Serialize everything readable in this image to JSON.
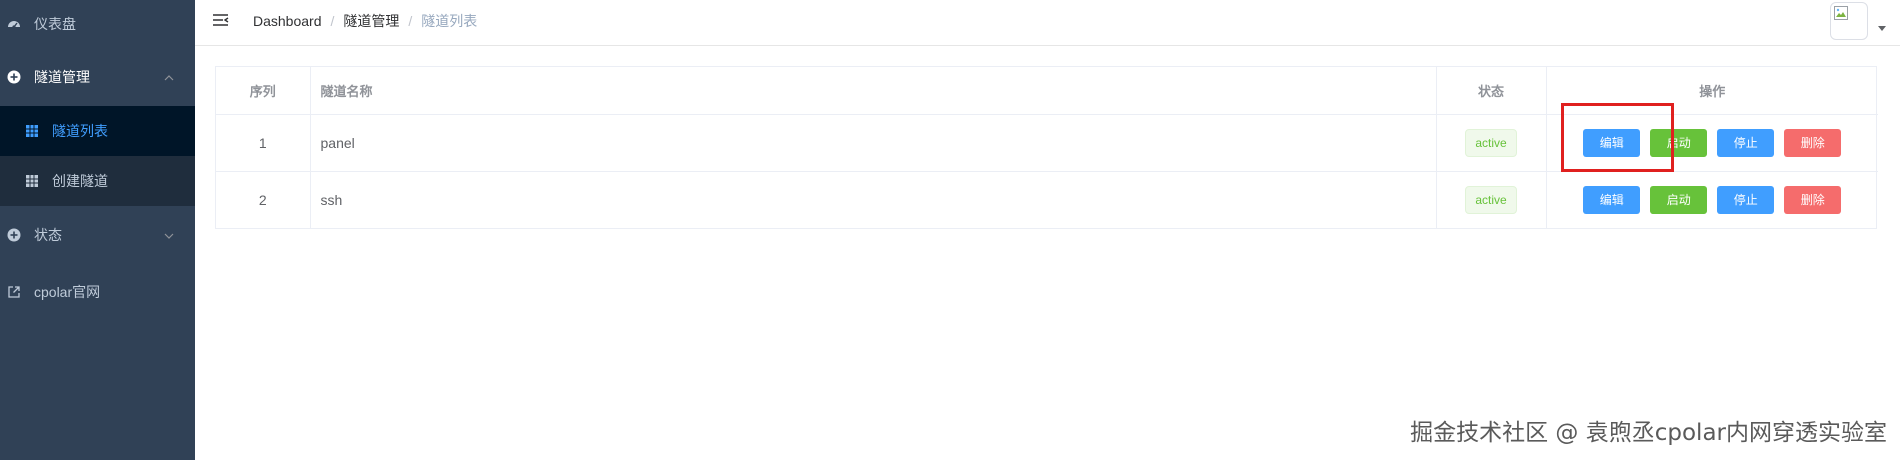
{
  "sidebar": {
    "dashboard": {
      "label": "仪表盘",
      "icon": "dashboard-icon"
    },
    "tunnel_group": {
      "label": "隧道管理",
      "icon": "plus-circle-icon",
      "expanded": true,
      "items": [
        {
          "label": "隧道列表",
          "icon": "table-icon",
          "active": true
        },
        {
          "label": "创建隧道",
          "icon": "table-icon",
          "active": false
        }
      ]
    },
    "status_group": {
      "label": "状态",
      "icon": "plus-circle-icon",
      "expanded": false
    },
    "external_link": {
      "label": "cpolar官网",
      "icon": "external-link-icon"
    }
  },
  "navbar": {
    "breadcrumb": [
      "Dashboard",
      "隧道管理",
      "隧道列表"
    ],
    "separator": "/"
  },
  "table": {
    "columns": [
      "序列",
      "隧道名称",
      "状态",
      "操作"
    ],
    "rows": [
      {
        "index": "1",
        "name": "panel",
        "status": "active"
      },
      {
        "index": "2",
        "name": "ssh",
        "status": "active"
      }
    ],
    "actions": {
      "edit": "编辑",
      "start": "启动",
      "stop": "停止",
      "delete": "删除"
    }
  },
  "colors": {
    "sidebar_bg": "#304156",
    "sidebar_active_bg": "#001528",
    "accent": "#409eff",
    "success": "#67c23a",
    "danger": "#f56c6c",
    "highlight_box": "#e0201f"
  },
  "watermark": "掘金技术社区 @ 袁煦丞cpolar内网穿透实验室"
}
